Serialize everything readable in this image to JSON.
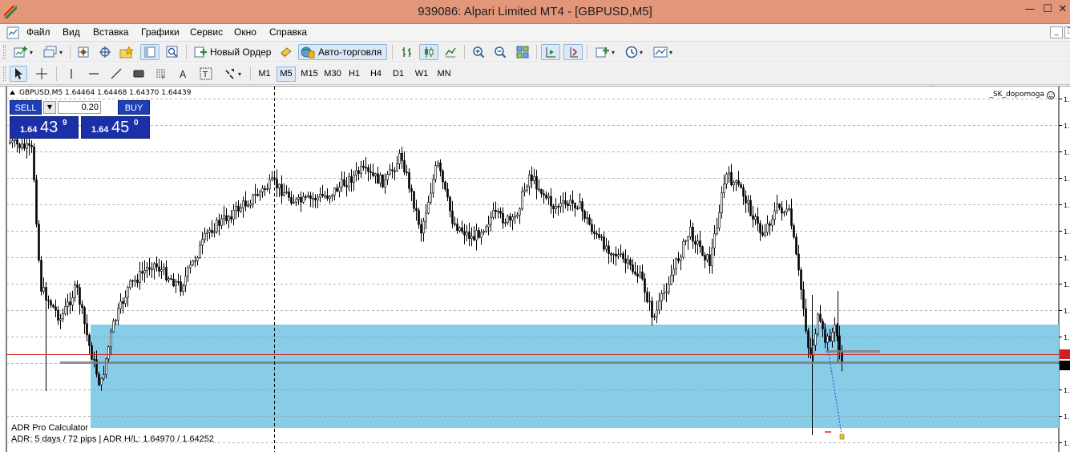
{
  "window": {
    "title": "939086: Alpari Limited MT4 - [GBPUSD,M5]",
    "minimize": "—",
    "maximize": "☐",
    "close": "✕"
  },
  "menu": {
    "items": [
      "Файл",
      "Вид",
      "Вставка",
      "Графики",
      "Сервис",
      "Окно",
      "Справка"
    ],
    "mdi_minimize": "_",
    "mdi_restore": "❐"
  },
  "toolbar": {
    "new_order_label": "Новый Ордер",
    "autotrading_label": "Авто-торговля",
    "search_placeholder": ""
  },
  "timeframes": [
    "M1",
    "M5",
    "M15",
    "M30",
    "H1",
    "H4",
    "D1",
    "W1",
    "MN"
  ],
  "timeframe_active": "M5",
  "chart": {
    "symbol_info": "GBPUSD,M5  1.64464 1.64468 1.64370 1.64439",
    "indicator_label": "_SK_dopomoga",
    "adr_title": "ADR Pro Calculator",
    "adr_info": "ADR: 5 days / 72 pips | ADR H/L: 1.64970 / 1.64252",
    "price_axis_label": "1.",
    "zone_color": "#87cde8",
    "bid_line_color": "#d02020"
  },
  "trade_panel": {
    "sell_label": "SELL",
    "buy_label": "BUY",
    "lot": "0.20",
    "bid_prefix": "1.64",
    "bid_big": "43",
    "bid_sup": "9",
    "ask_prefix": "1.64",
    "ask_big": "45",
    "ask_sup": "0",
    "panel_color": "#1a2fa8"
  }
}
